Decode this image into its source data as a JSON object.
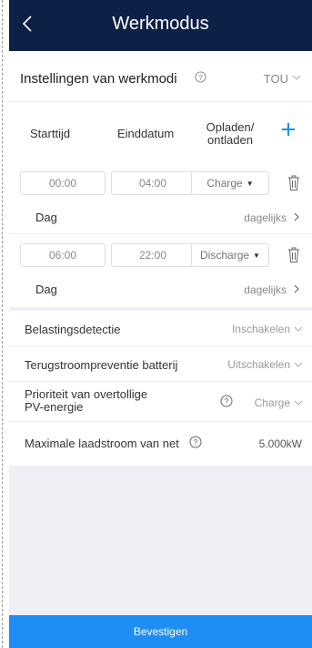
{
  "header": {
    "title": "Werkmodus"
  },
  "modes": {
    "label": "Instellingen van werkmodi",
    "value": "TOU"
  },
  "tou": {
    "col_start": "Starttijd",
    "col_end": "Einddatum",
    "col_charge_line1": "Opladen/",
    "col_charge_line2": "ontladen",
    "slots": [
      {
        "start": "00:00",
        "end": "04:00",
        "mode": "Charge",
        "day_label": "Dag",
        "day_value": "dagelijks"
      },
      {
        "start": "06:00",
        "end": "22:00",
        "mode": "Discharge",
        "day_label": "Dag",
        "day_value": "dagelijks"
      }
    ]
  },
  "settings": {
    "load_detection": {
      "label": "Belastingsdetectie",
      "value": "Inschakelen"
    },
    "backflow": {
      "label": "Terugstroompreventie batterij",
      "value": "Uitschakelen"
    },
    "surplus_pv": {
      "label_line1": "Prioriteit van overtollige",
      "label_line2": "PV-energie",
      "value": "Charge"
    },
    "max_grid_charge": {
      "label": "Maximale laadstroom van net",
      "value": "5.000kW"
    }
  },
  "footer": {
    "confirm_label": "Bevestigen"
  },
  "colors": {
    "header_bg": "#0d2147",
    "accent": "#1e8ef5",
    "page_bg": "#eef0f6"
  }
}
